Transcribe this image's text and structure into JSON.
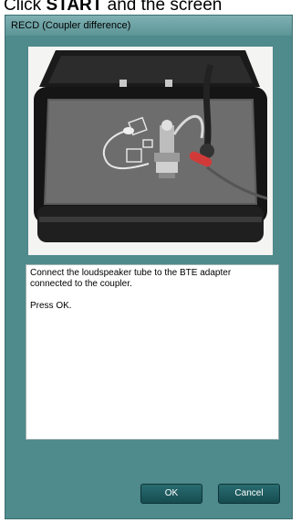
{
  "caption": {
    "prefix": "Click ",
    "bold": "START",
    "suffix": " and the screen"
  },
  "dialog": {
    "title": "RECD (Coupler difference)",
    "message_line1": "Connect the loudspeaker tube to the BTE adapter connected to the coupler.",
    "message_line2": "Press OK.",
    "ok_label": "OK",
    "cancel_label": "Cancel"
  },
  "colors": {
    "dialog_background": "#4f8a8c",
    "button": "#1d5b5f",
    "coupler_cable": "#d23a3a"
  }
}
